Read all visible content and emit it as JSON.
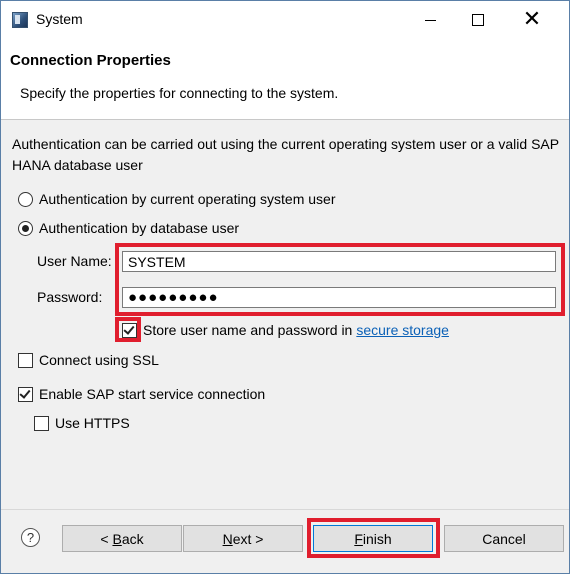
{
  "window": {
    "title": "System"
  },
  "header": {
    "title": "Connection Properties",
    "description": "Specify the properties for connecting to the system."
  },
  "intro": "Authentication can be carried out using the current operating system user or a valid SAP HANA database user",
  "auth": {
    "options": [
      {
        "label": "Authentication by current operating system user",
        "selected": false
      },
      {
        "label": "Authentication by database user",
        "selected": true
      }
    ]
  },
  "fields": {
    "user_label": "User Name:",
    "user_value": "SYSTEM",
    "password_label": "Password:",
    "password_value": "●●●●●●●●●"
  },
  "store": {
    "label": "Store user name and password in",
    "link": "secure storage",
    "checked": true
  },
  "ssl": {
    "label": "Connect using SSL",
    "checked": false
  },
  "sap_start": {
    "label": "Enable SAP start service connection",
    "checked": true
  },
  "https": {
    "label": "Use HTTPS",
    "checked": false
  },
  "buttons": {
    "help": "?",
    "back_prefix": "< ",
    "back_mnemonic": "B",
    "back_rest": "ack",
    "next_mnemonic": "N",
    "next_rest": "ext >",
    "finish_mnemonic": "F",
    "finish_rest": "inish",
    "cancel": "Cancel"
  },
  "colors": {
    "highlight": "#e01e2e",
    "link": "#0b61b7",
    "focus": "#0078d7"
  }
}
